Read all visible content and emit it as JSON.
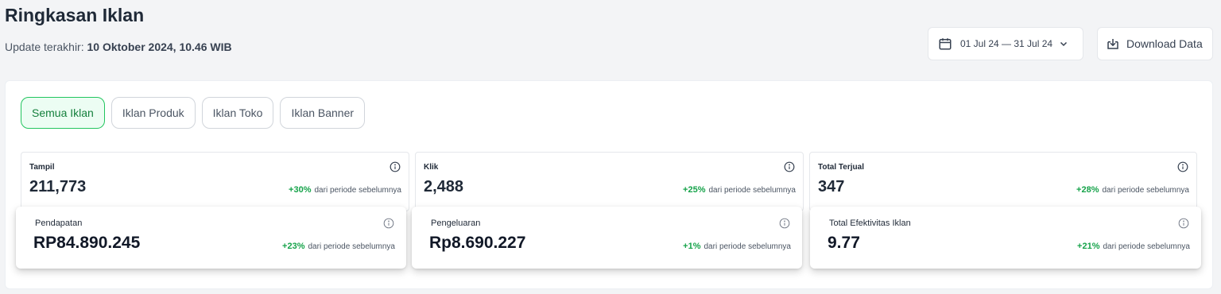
{
  "header": {
    "title": "Ringkasan Iklan",
    "update_prefix": "Update terakhir: ",
    "update_value": "10 Oktober 2024, 10.46 WIB"
  },
  "toolbar": {
    "date_range": "01 Jul 24 — 31 Jul 24",
    "download_label": "Download Data"
  },
  "tabs": [
    {
      "label": "Semua Iklan",
      "active": true
    },
    {
      "label": "Iklan Produk",
      "active": false
    },
    {
      "label": "Iklan Toko",
      "active": false
    },
    {
      "label": "Iklan Banner",
      "active": false
    }
  ],
  "metrics_top": [
    {
      "label": "Tampil",
      "value": "211,773",
      "change": "+30%",
      "change_text": "dari periode sebelumnya"
    },
    {
      "label": "Klik",
      "value": "2,488",
      "change": "+25%",
      "change_text": "dari periode sebelumnya"
    },
    {
      "label": "Total Terjual",
      "value": "347",
      "change": "+28%",
      "change_text": "dari periode sebelumnya"
    }
  ],
  "metrics_bottom": [
    {
      "label": "Pendapatan",
      "value": "RP84.890.245",
      "change": "+23%",
      "change_text": "dari periode sebelumnya"
    },
    {
      "label": "Pengeluaran",
      "value": "Rp8.690.227",
      "change": "+1%",
      "change_text": "dari periode sebelumnya"
    },
    {
      "label": "Total Efektivitas Iklan",
      "value": "9.77",
      "change": "+21%",
      "change_text": "dari periode sebelumnya"
    }
  ],
  "colors": {
    "accent_green": "#16a34a",
    "active_tab_bg": "#ecfdf3",
    "active_tab_border": "#22c55e"
  },
  "icons": {
    "date": "calendar-icon",
    "date_dropdown": "chevron-down-icon",
    "download": "download-icon",
    "info": "info-icon"
  }
}
